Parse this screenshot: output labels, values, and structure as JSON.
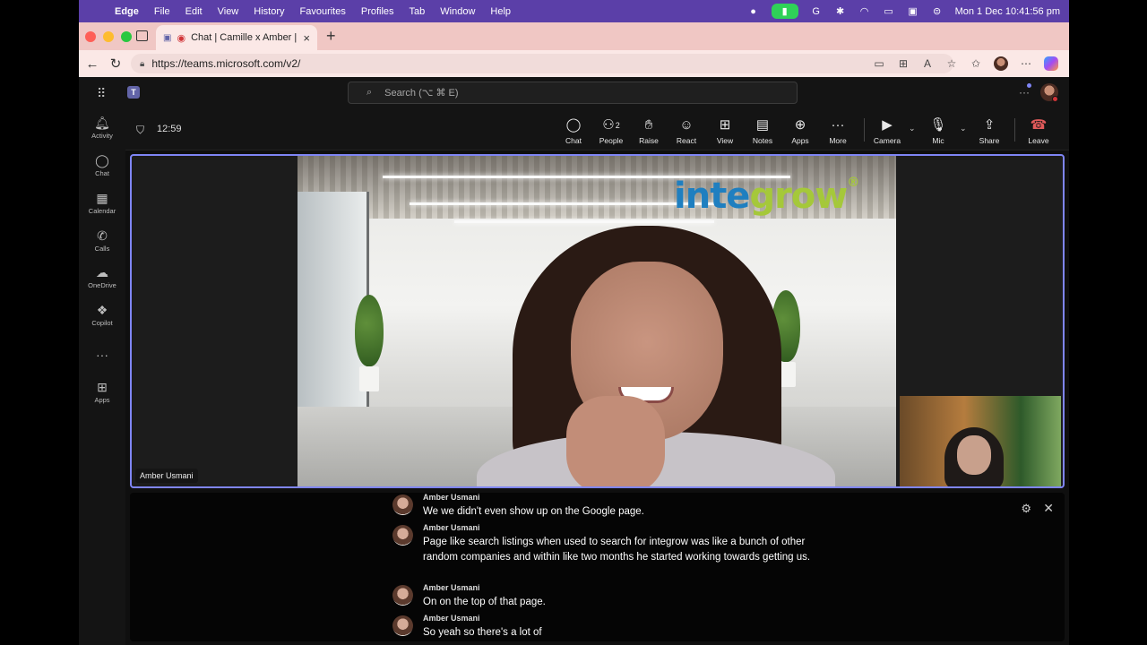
{
  "menubar": {
    "apple_glyph": "",
    "app_name": "Edge",
    "items": [
      "File",
      "Edit",
      "View",
      "History",
      "Favourites",
      "Profiles",
      "Tab",
      "Window",
      "Help"
    ],
    "datetime": "Mon 1 Dec  10:41:56 pm"
  },
  "browser": {
    "tab_title": "Chat | Camille x Amber | Int",
    "tab_close": "×",
    "new_tab": "+",
    "url": "https://teams.microsoft.com/v2/"
  },
  "teams": {
    "search_placeholder": "Search (⌥ ⌘ E)",
    "rail": [
      {
        "label": "Activity",
        "icon": "bell-icon"
      },
      {
        "label": "Chat",
        "icon": "chat-icon"
      },
      {
        "label": "Calendar",
        "icon": "calendar-icon"
      },
      {
        "label": "Calls",
        "icon": "phone-icon"
      },
      {
        "label": "OneDrive",
        "icon": "cloud-icon"
      },
      {
        "label": "Copilot",
        "icon": "copilot-icon"
      },
      {
        "label": "",
        "icon": "more-icon"
      },
      {
        "label": "Apps",
        "icon": "plus-square-icon"
      }
    ]
  },
  "meeting": {
    "timer": "12:59",
    "controls": {
      "chat": "Chat",
      "people": "People",
      "people_count": "2",
      "raise": "Raise",
      "react": "React",
      "view": "View",
      "notes": "Notes",
      "apps": "Apps",
      "more": "More",
      "camera": "Camera",
      "mic": "Mic",
      "share": "Share",
      "leave": "Leave"
    },
    "speaker_name": "Amber Usmani",
    "logo_text_a": "inte",
    "logo_text_b": "grow",
    "logo_mark": "®"
  },
  "captions": [
    {
      "speaker": "Amber Usmani",
      "text": "We we didn't even show up on the Google page."
    },
    {
      "speaker": "Amber Usmani",
      "text": "Page like search listings when used to search for integrow was like a bunch of other random companies and within like two months he started working towards getting us."
    },
    {
      "speaker": "Amber Usmani",
      "text": "On on the top of that page."
    },
    {
      "speaker": "Amber Usmani",
      "text": "So yeah so there's a lot of"
    }
  ],
  "colors": {
    "menubar": "#5b3fa8",
    "tabbar": "#f0c7c4",
    "teams_accent": "#7f85f5",
    "leave_red": "#e05a5a",
    "camera_on_pill": "#2fd158"
  }
}
